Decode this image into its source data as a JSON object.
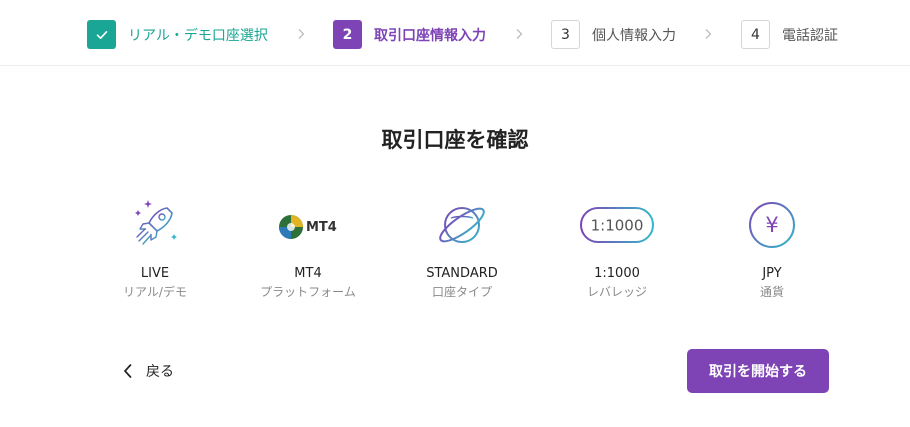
{
  "stepper": {
    "steps": [
      {
        "number": "",
        "label": "リアル・デモ口座選択",
        "state": "done"
      },
      {
        "number": "2",
        "label": "取引口座情報入力",
        "state": "active"
      },
      {
        "number": "3",
        "label": "個人情報入力",
        "state": "pending"
      },
      {
        "number": "4",
        "label": "電話認証",
        "state": "pending"
      }
    ]
  },
  "main": {
    "title": "取引口座を確認",
    "items": [
      {
        "value": "LIVE",
        "label": "リアル/デモ",
        "icon": "rocket-icon"
      },
      {
        "value": "MT4",
        "label": "プラットフォーム",
        "icon": "mt4-logo-icon",
        "logo_text": "MT4"
      },
      {
        "value": "STANDARD",
        "label": "口座タイプ",
        "icon": "planet-icon"
      },
      {
        "value": "1:1000",
        "label": "レバレッジ",
        "icon": "leverage-badge-icon",
        "badge_text": "1:1000"
      },
      {
        "value": "JPY",
        "label": "通貨",
        "icon": "yen-icon",
        "symbol": "¥"
      }
    ]
  },
  "footer": {
    "back_label": "戻る",
    "start_label": "取引を開始する"
  },
  "colors": {
    "accent": "#7e44b6",
    "done": "#1aa694",
    "gradient_start": "#7e44b6",
    "gradient_end": "#33b8c9"
  }
}
